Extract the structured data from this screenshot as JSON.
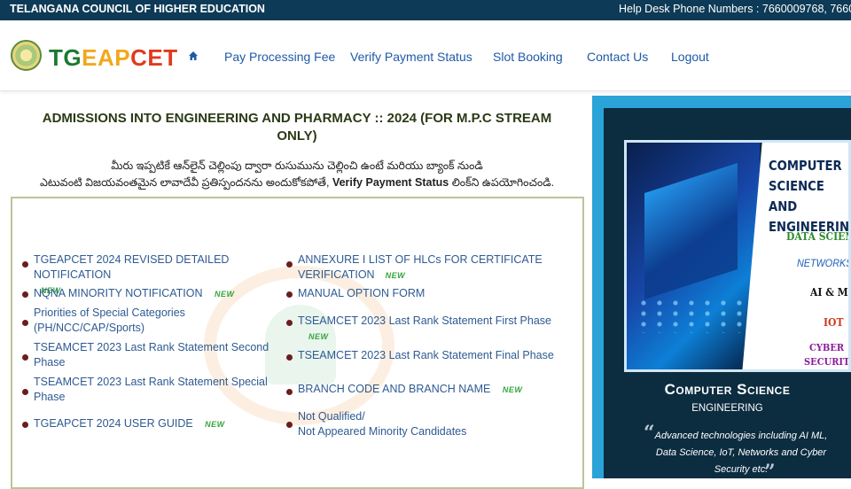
{
  "topbar": {
    "org": "TELANGANA COUNCIL OF HIGHER EDUCATION",
    "help": "Help Desk Phone Numbers : 7660009768, 766000"
  },
  "brand": {
    "tg": "TG",
    "eap": "EAP",
    "cet": "CET"
  },
  "nav": {
    "home_icon": "home-icon",
    "items": [
      "Pay Processing Fee",
      "Verify Payment Status",
      "Slot Booking",
      "Contact Us",
      "Logout"
    ]
  },
  "main": {
    "title_line1": "ADMISSIONS INTO ENGINEERING AND PHARMACY :: 2024  (FOR M.P.C STREAM",
    "title_line2": "ONLY)",
    "telugu_line1": "మీరు ఇప్పటికే ఆన్‌లైన్ చెల్లింపు ద్వారా రుసుమును చెల్లించి ఉంటే మరియు బ్యాంక్ నుండి",
    "telugu_line2_a": "ఎటువంటి విజయవంతమైన లావాదేవీ ప్రతిస్పందనను అందుకోకపోతే, ",
    "telugu_link": "Verify Payment Status",
    "telugu_line2_b": " లింక్‌ని ఉపయోగించండి.",
    "new_badge": "NEW",
    "left_links": [
      {
        "l1": "TGEAPCET 2024 REVISED DETAILED NOTIFICATION",
        "l2": ""
      },
      {
        "l1": "NQNA MINORITY NOTIFICATION",
        "l2": ""
      },
      {
        "l1": "Priorities of Special Categories",
        "l2": "(PH/NCC/CAP/Sports)"
      },
      {
        "l1": "TSEAMCET 2023 Last Rank Statement Second",
        "l2": "Phase"
      },
      {
        "l1": "TSEAMCET 2023 Last Rank Statement Special",
        "l2": "Phase"
      },
      {
        "l1": "TGEAPCET 2024 USER GUIDE",
        "l2": ""
      }
    ],
    "right_links": [
      {
        "l1": "ANNEXURE I LIST OF HLCs FOR CERTIFICATE",
        "l2": "VERIFICATION"
      },
      {
        "l1": "MANUAL OPTION FORM",
        "l2": ""
      },
      {
        "l1": "TSEAMCET 2023 Last Rank Statement First Phase",
        "l2": ""
      },
      {
        "l1": "TSEAMCET 2023 Last Rank Statement Final Phase",
        "l2": ""
      },
      {
        "l1": "BRANCH CODE AND BRANCH NAME",
        "l2": ""
      },
      {
        "l1": "Not Qualified/",
        "l2": "Not Appeared Minority Candidates"
      }
    ]
  },
  "sidebar": {
    "promo": {
      "heading": "COMPUTER SCIENCE AND ENGINEERING",
      "tags": [
        "DATA SCIENCE",
        "NETWORKS",
        "AI & ML",
        "IOT",
        "CYBER",
        "SECURITY"
      ]
    },
    "title": "Computer Science",
    "subtitle": "ENGINEERING",
    "desc": "Advanced technologies including AI ML, Data Science, IoT, Networks and Cyber Security etc."
  }
}
